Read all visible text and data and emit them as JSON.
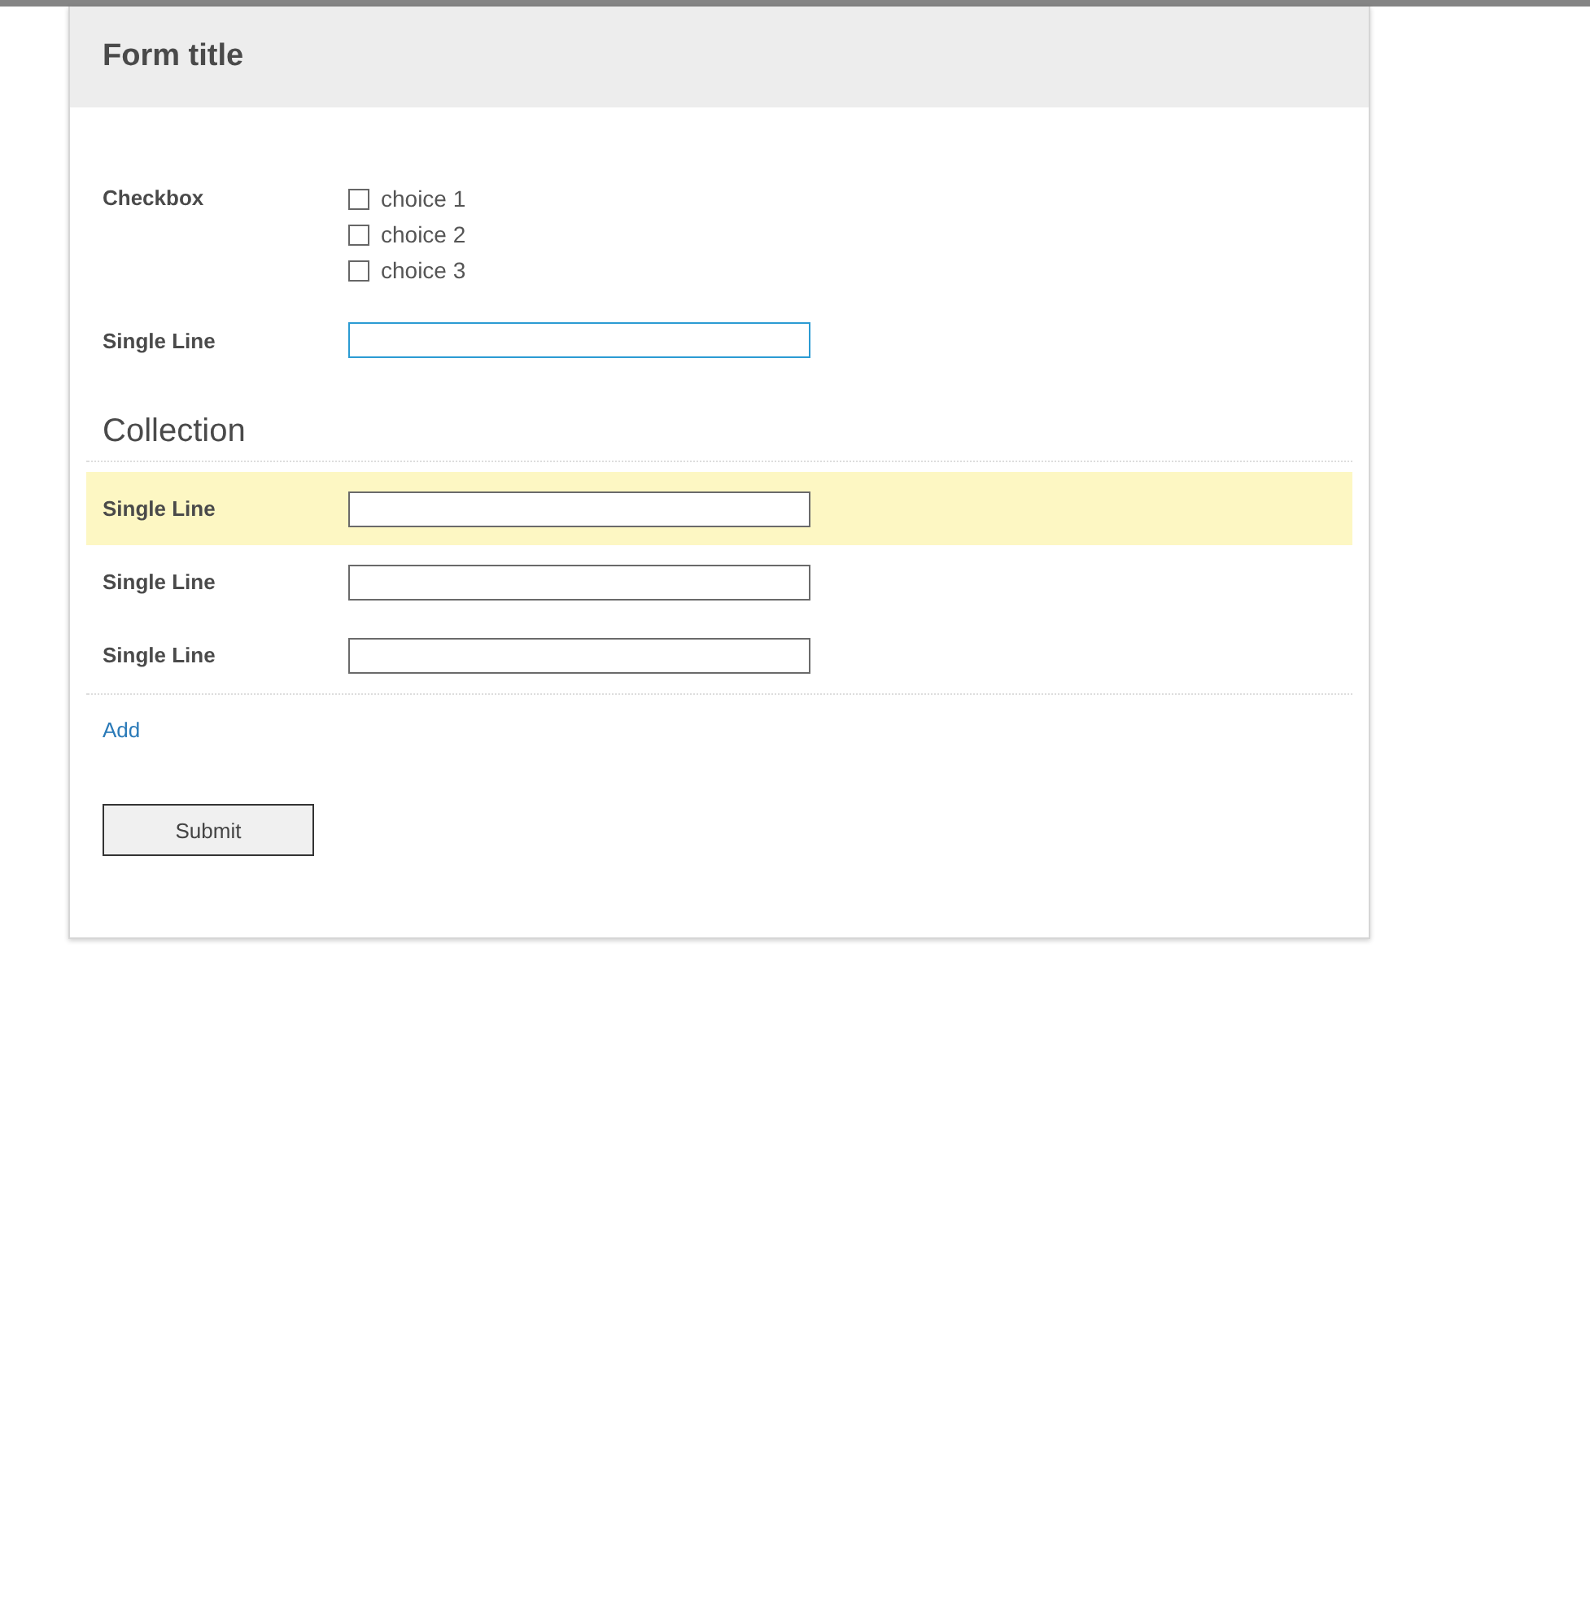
{
  "form": {
    "title": "Form title",
    "checkbox_field": {
      "label": "Checkbox",
      "choices": [
        {
          "label": "choice 1",
          "checked": false
        },
        {
          "label": "choice 2",
          "checked": false
        },
        {
          "label": "choice 3",
          "checked": false
        }
      ]
    },
    "single_line": {
      "label": "Single Line",
      "focused": true
    },
    "collection": {
      "heading": "Collection",
      "items": [
        {
          "label": "Single Line",
          "highlighted": true
        },
        {
          "label": "Single Line",
          "highlighted": false
        },
        {
          "label": "Single Line",
          "highlighted": false
        }
      ],
      "add_link": "Add"
    },
    "submit": "Submit"
  }
}
